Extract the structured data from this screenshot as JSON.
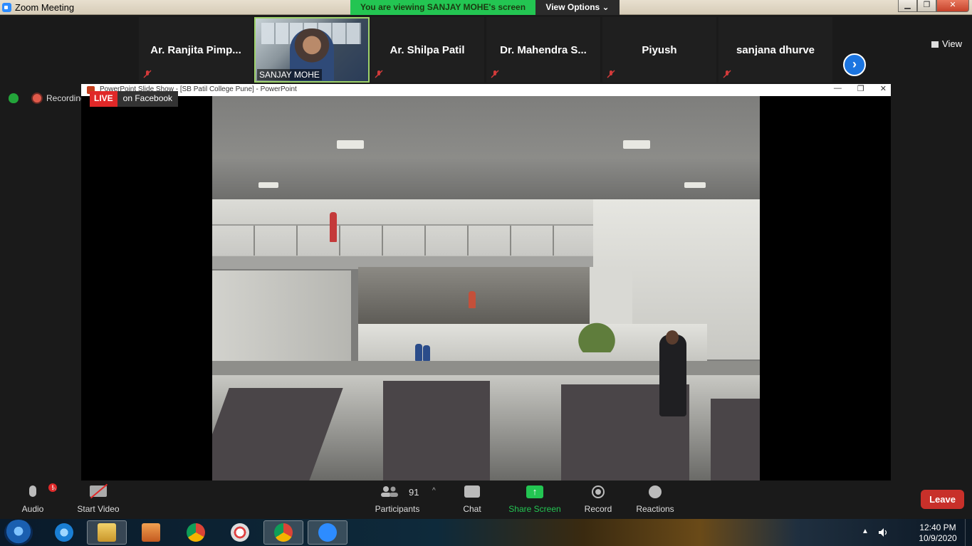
{
  "window": {
    "title": "Zoom Meeting",
    "viewing_banner": "You are viewing SANJAY MOHE's screen",
    "view_options": "View Options ⌄",
    "controls": {
      "minimize": "▁",
      "restore": "❐",
      "close": "✕"
    }
  },
  "gallery": {
    "participants": [
      {
        "name": "Ar. Ranjita Pimp...",
        "muted": true
      },
      {
        "name": "Ar. Shilpa Patil",
        "muted": true
      },
      {
        "name": "Dr. Mahendra S...",
        "muted": true
      },
      {
        "name": "Piyush",
        "muted": true
      },
      {
        "name": "sanjana dhurve",
        "muted": true
      }
    ],
    "active_speaker": "SANJAY MOHE",
    "view_label": "View",
    "next_label": "›"
  },
  "status": {
    "recording": "Recording",
    "live": "LIVE",
    "live_target": "on Facebook"
  },
  "shared_window": {
    "title": "PowerPoint Slide Show - [SB Patil College Pune] - PowerPoint",
    "controls": {
      "minimize": "—",
      "restore": "❐",
      "close": "✕"
    }
  },
  "toolbar": {
    "audio": "Audio",
    "audio_badge": "!",
    "start_video": "Start Video",
    "participants": "Participants",
    "participant_count": "91",
    "chat": "Chat",
    "share_screen": "Share Screen",
    "share_arrow": "↑",
    "record": "Record",
    "reactions": "Reactions",
    "leave": "Leave",
    "caret": "^"
  },
  "taskbar": {
    "time": "12:40 PM",
    "date": "10/9/2020",
    "tray_caret": "▲"
  },
  "colors": {
    "zoom_blue": "#2d8cff",
    "banner_green": "#23c552",
    "live_red": "#e02828",
    "leave_red": "#c8302a"
  }
}
